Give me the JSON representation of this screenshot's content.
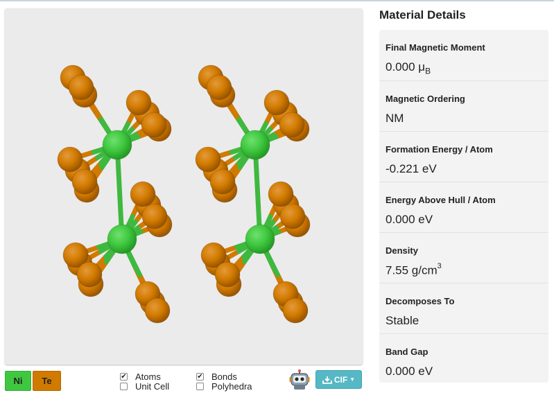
{
  "elements": [
    {
      "symbol": "Ni",
      "color": "#3fc83f"
    },
    {
      "symbol": "Te",
      "color": "#d17a00"
    }
  ],
  "toggles": [
    {
      "label": "Atoms",
      "checked": true
    },
    {
      "label": "Unit Cell",
      "checked": false
    },
    {
      "label": "Bonds",
      "checked": true
    },
    {
      "label": "Polyhedra",
      "checked": false
    }
  ],
  "export": {
    "label": "CIF"
  },
  "details": {
    "title": "Material Details",
    "rows": [
      {
        "label": "Final Magnetic Moment",
        "value": "0.000 μ",
        "sub": "B"
      },
      {
        "label": "Magnetic Ordering",
        "value": "NM"
      },
      {
        "label": "Formation Energy / Atom",
        "value": "-0.221 eV"
      },
      {
        "label": "Energy Above Hull / Atom",
        "value": "0.000 eV"
      },
      {
        "label": "Density",
        "value": "7.55 g/cm",
        "sup": "3"
      },
      {
        "label": "Decomposes To",
        "value": "Stable"
      },
      {
        "label": "Band Gap",
        "value": "0.000 eV"
      }
    ]
  },
  "colors": {
    "ni_atom": "#3fc83f",
    "te_atom": "#d17a00",
    "bond_ni": "#3fb83f",
    "bond_te": "#d17a00",
    "button": "#55b8c4"
  }
}
